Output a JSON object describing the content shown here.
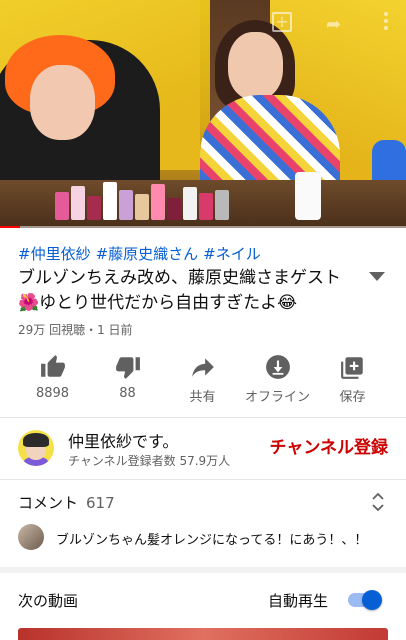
{
  "video": {
    "progress_percent": 5
  },
  "tags": [
    "#仲里依紗",
    "#藤原史織さん",
    "#ネイル"
  ],
  "title": "ブルゾンちえみ改め、藤原史織さまゲスト🌺ゆとり世代だから自由すぎたよ😂",
  "meta": "29万 回視聴・1 日前",
  "actions": {
    "like": {
      "label": "8898",
      "icon": "thumbs-up-icon"
    },
    "dislike": {
      "label": "88",
      "icon": "thumbs-down-icon"
    },
    "share": {
      "label": "共有",
      "icon": "share-icon"
    },
    "offline": {
      "label": "オフライン",
      "icon": "download-icon"
    },
    "save": {
      "label": "保存",
      "icon": "add-to-playlist-icon"
    }
  },
  "channel": {
    "name": "仲里依紗です。",
    "subscribers": "チャンネル登録者数 57.9万人",
    "subscribe_label": "チャンネル登録",
    "subscribe_color": "#cc0000"
  },
  "comments": {
    "heading": "コメント",
    "count": "617",
    "top_comment": "ブルゾンちゃん髪オレンジになってる！にあう！、！"
  },
  "up_next": {
    "label": "次の動画",
    "autoplay_label": "自動再生",
    "autoplay_on": true,
    "accent_color": "#065fd4"
  }
}
